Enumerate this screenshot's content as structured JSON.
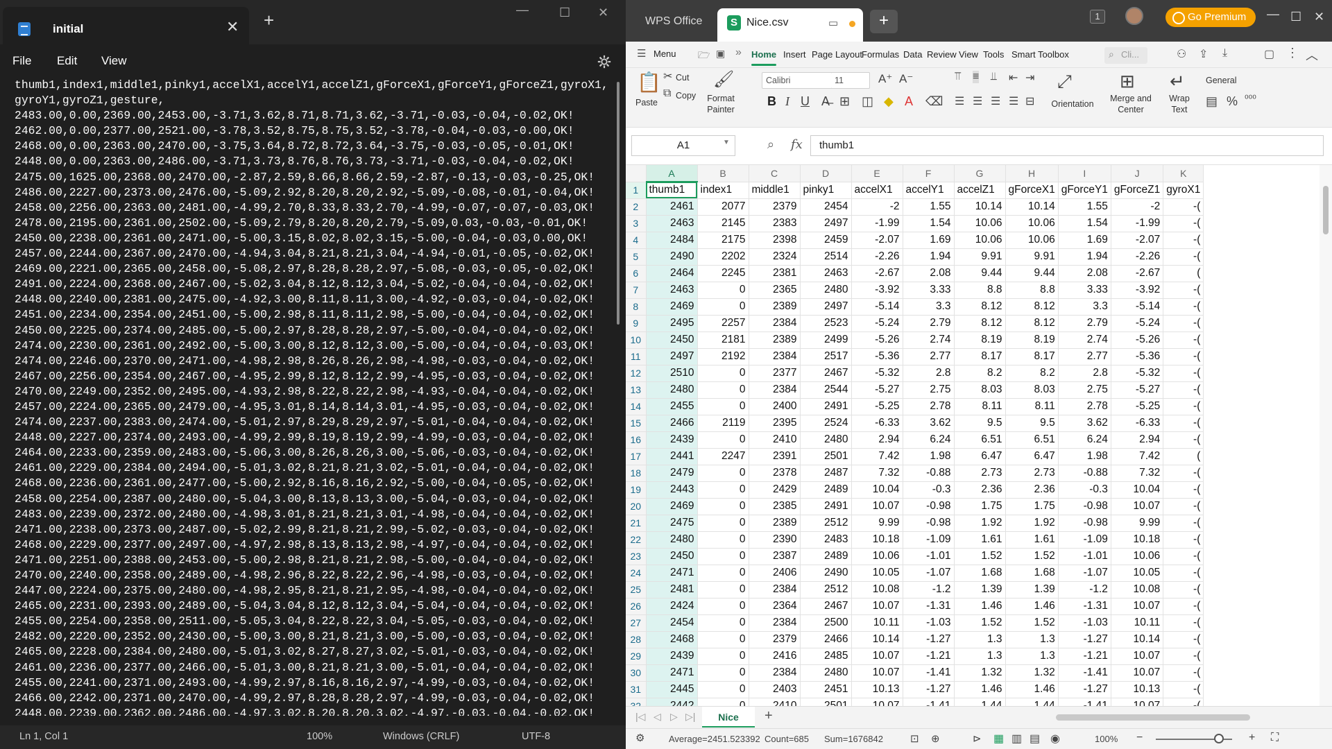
{
  "notepad": {
    "tab_title": "initial",
    "menu": [
      "File",
      "Edit",
      "View"
    ],
    "content": "thumb1,index1,middle1,pinky1,accelX1,accelY1,accelZ1,gForceX1,gForceY1,gForceZ1,gyroX1,gyroY1,gyroZ1,gesture,\n2483.00,0.00,2369.00,2453.00,-3.71,3.62,8.71,8.71,3.62,-3.71,-0.03,-0.04,-0.02,OK!\n2462.00,0.00,2377.00,2521.00,-3.78,3.52,8.75,8.75,3.52,-3.78,-0.04,-0.03,-0.00,OK!\n2468.00,0.00,2363.00,2470.00,-3.75,3.64,8.72,8.72,3.64,-3.75,-0.03,-0.05,-0.01,OK!\n2448.00,0.00,2363.00,2486.00,-3.71,3.73,8.76,8.76,3.73,-3.71,-0.03,-0.04,-0.02,OK!\n2475.00,1625.00,2368.00,2470.00,-2.87,2.59,8.66,8.66,2.59,-2.87,-0.13,-0.03,-0.25,OK!\n2486.00,2227.00,2373.00,2476.00,-5.09,2.92,8.20,8.20,2.92,-5.09,-0.08,-0.01,-0.04,OK!\n2458.00,2256.00,2363.00,2481.00,-4.99,2.70,8.33,8.33,2.70,-4.99,-0.07,-0.07,-0.03,OK!\n2478.00,2195.00,2361.00,2502.00,-5.09,2.79,8.20,8.20,2.79,-5.09,0.03,-0.03,-0.01,OK!\n2450.00,2238.00,2361.00,2471.00,-5.00,3.15,8.02,8.02,3.15,-5.00,-0.04,-0.03,0.00,OK!\n2457.00,2244.00,2367.00,2470.00,-4.94,3.04,8.21,8.21,3.04,-4.94,-0.01,-0.05,-0.02,OK!\n2469.00,2221.00,2365.00,2458.00,-5.08,2.97,8.28,8.28,2.97,-5.08,-0.03,-0.05,-0.02,OK!\n2491.00,2224.00,2368.00,2467.00,-5.02,3.04,8.12,8.12,3.04,-5.02,-0.04,-0.04,-0.02,OK!\n2448.00,2240.00,2381.00,2475.00,-4.92,3.00,8.11,8.11,3.00,-4.92,-0.03,-0.04,-0.02,OK!\n2451.00,2234.00,2354.00,2451.00,-5.00,2.98,8.11,8.11,2.98,-5.00,-0.04,-0.04,-0.02,OK!\n2450.00,2225.00,2374.00,2485.00,-5.00,2.97,8.28,8.28,2.97,-5.00,-0.04,-0.04,-0.02,OK!\n2474.00,2230.00,2361.00,2492.00,-5.00,3.00,8.12,8.12,3.00,-5.00,-0.04,-0.04,-0.03,OK!\n2474.00,2246.00,2370.00,2471.00,-4.98,2.98,8.26,8.26,2.98,-4.98,-0.03,-0.04,-0.02,OK!\n2467.00,2256.00,2354.00,2467.00,-4.95,2.99,8.12,8.12,2.99,-4.95,-0.03,-0.04,-0.02,OK!\n2470.00,2249.00,2352.00,2495.00,-4.93,2.98,8.22,8.22,2.98,-4.93,-0.04,-0.04,-0.02,OK!\n2457.00,2224.00,2365.00,2479.00,-4.95,3.01,8.14,8.14,3.01,-4.95,-0.03,-0.04,-0.02,OK!\n2474.00,2237.00,2383.00,2474.00,-5.01,2.97,8.29,8.29,2.97,-5.01,-0.04,-0.04,-0.02,OK!\n2448.00,2227.00,2374.00,2493.00,-4.99,2.99,8.19,8.19,2.99,-4.99,-0.03,-0.04,-0.02,OK!\n2464.00,2233.00,2359.00,2483.00,-5.06,3.00,8.26,8.26,3.00,-5.06,-0.03,-0.04,-0.02,OK!\n2461.00,2229.00,2384.00,2494.00,-5.01,3.02,8.21,8.21,3.02,-5.01,-0.04,-0.04,-0.02,OK!\n2468.00,2236.00,2361.00,2477.00,-5.00,2.92,8.16,8.16,2.92,-5.00,-0.04,-0.05,-0.02,OK!\n2458.00,2254.00,2387.00,2480.00,-5.04,3.00,8.13,8.13,3.00,-5.04,-0.03,-0.04,-0.02,OK!\n2483.00,2239.00,2372.00,2480.00,-4.98,3.01,8.21,8.21,3.01,-4.98,-0.04,-0.04,-0.02,OK!\n2471.00,2238.00,2373.00,2487.00,-5.02,2.99,8.21,8.21,2.99,-5.02,-0.03,-0.04,-0.02,OK!\n2468.00,2229.00,2377.00,2497.00,-4.97,2.98,8.13,8.13,2.98,-4.97,-0.04,-0.04,-0.02,OK!\n2471.00,2251.00,2388.00,2453.00,-5.00,2.98,8.21,8.21,2.98,-5.00,-0.04,-0.04,-0.02,OK!\n2470.00,2240.00,2358.00,2489.00,-4.98,2.96,8.22,8.22,2.96,-4.98,-0.03,-0.04,-0.02,OK!\n2447.00,2224.00,2375.00,2480.00,-4.98,2.95,8.21,8.21,2.95,-4.98,-0.04,-0.04,-0.02,OK!\n2465.00,2231.00,2393.00,2489.00,-5.04,3.04,8.12,8.12,3.04,-5.04,-0.04,-0.04,-0.02,OK!\n2455.00,2254.00,2358.00,2511.00,-5.05,3.04,8.22,8.22,3.04,-5.05,-0.03,-0.04,-0.02,OK!\n2482.00,2220.00,2352.00,2430.00,-5.00,3.00,8.21,8.21,3.00,-5.00,-0.03,-0.04,-0.02,OK!\n2465.00,2228.00,2384.00,2480.00,-5.01,3.02,8.27,8.27,3.02,-5.01,-0.03,-0.04,-0.02,OK!\n2461.00,2236.00,2377.00,2466.00,-5.01,3.00,8.21,8.21,3.00,-5.01,-0.04,-0.04,-0.02,OK!\n2455.00,2241.00,2371.00,2493.00,-4.99,2.97,8.16,8.16,2.97,-4.99,-0.03,-0.04,-0.02,OK!\n2466.00,2242.00,2371.00,2470.00,-4.99,2.97,8.28,8.28,2.97,-4.99,-0.03,-0.04,-0.02,OK!\n2448.00,2239.00,2362.00,2486.00,-4.97,3.02,8.20,8.20,3.02,-4.97,-0.03,-0.04,-0.02,OK!",
    "status": {
      "position": "Ln 1, Col 1",
      "zoom": "100%",
      "line_ending": "Windows (CRLF)",
      "encoding": "UTF-8"
    }
  },
  "wps": {
    "app_tab": "WPS Office",
    "file_tab": "Nice.csv",
    "badge": "1",
    "premium": "Go Premium",
    "menu_label": "Menu",
    "ribbon_tabs": [
      "Home",
      "Insert",
      "Page Layout",
      "Formulas",
      "Data",
      "Review",
      "View",
      "Tools",
      "Smart Toolbox"
    ],
    "search_placeholder": "Cli...",
    "ribbon": {
      "paste": "Paste",
      "cut": "Cut",
      "copy": "Copy",
      "format_painter_1": "Format",
      "format_painter_2": "Painter",
      "font": "Calibri",
      "size": "11",
      "orientation": "Orientation",
      "merge_1": "Merge and",
      "merge_2": "Center",
      "wrap_1": "Wrap",
      "wrap_2": "Text",
      "number_format": "General"
    },
    "name_box": "A1",
    "formula": "thumb1",
    "columns": [
      "A",
      "B",
      "C",
      "D",
      "E",
      "F",
      "G",
      "H",
      "I",
      "J",
      "K"
    ],
    "rows": [
      [
        "thumb1",
        "index1",
        "middle1",
        "pinky1",
        "accelX1",
        "accelY1",
        "accelZ1",
        "gForceX1",
        "gForceY1",
        "gForceZ1",
        "gyroX1"
      ],
      [
        "2461",
        "2077",
        "2379",
        "2454",
        "-2",
        "1.55",
        "10.14",
        "10.14",
        "1.55",
        "-2",
        "-("
      ],
      [
        "2463",
        "2145",
        "2383",
        "2497",
        "-1.99",
        "1.54",
        "10.06",
        "10.06",
        "1.54",
        "-1.99",
        "-("
      ],
      [
        "2484",
        "2175",
        "2398",
        "2459",
        "-2.07",
        "1.69",
        "10.06",
        "10.06",
        "1.69",
        "-2.07",
        "-("
      ],
      [
        "2490",
        "2202",
        "2324",
        "2514",
        "-2.26",
        "1.94",
        "9.91",
        "9.91",
        "1.94",
        "-2.26",
        "-("
      ],
      [
        "2464",
        "2245",
        "2381",
        "2463",
        "-2.67",
        "2.08",
        "9.44",
        "9.44",
        "2.08",
        "-2.67",
        "("
      ],
      [
        "2463",
        "0",
        "2365",
        "2480",
        "-3.92",
        "3.33",
        "8.8",
        "8.8",
        "3.33",
        "-3.92",
        "-("
      ],
      [
        "2469",
        "0",
        "2389",
        "2497",
        "-5.14",
        "3.3",
        "8.12",
        "8.12",
        "3.3",
        "-5.14",
        "-("
      ],
      [
        "2495",
        "2257",
        "2384",
        "2523",
        "-5.24",
        "2.79",
        "8.12",
        "8.12",
        "2.79",
        "-5.24",
        "-("
      ],
      [
        "2450",
        "2181",
        "2389",
        "2499",
        "-5.26",
        "2.74",
        "8.19",
        "8.19",
        "2.74",
        "-5.26",
        "-("
      ],
      [
        "2497",
        "2192",
        "2384",
        "2517",
        "-5.36",
        "2.77",
        "8.17",
        "8.17",
        "2.77",
        "-5.36",
        "-("
      ],
      [
        "2510",
        "0",
        "2377",
        "2467",
        "-5.32",
        "2.8",
        "8.2",
        "8.2",
        "2.8",
        "-5.32",
        "-("
      ],
      [
        "2480",
        "0",
        "2384",
        "2544",
        "-5.27",
        "2.75",
        "8.03",
        "8.03",
        "2.75",
        "-5.27",
        "-("
      ],
      [
        "2455",
        "0",
        "2400",
        "2491",
        "-5.25",
        "2.78",
        "8.11",
        "8.11",
        "2.78",
        "-5.25",
        "-("
      ],
      [
        "2466",
        "2119",
        "2395",
        "2524",
        "-6.33",
        "3.62",
        "9.5",
        "9.5",
        "3.62",
        "-6.33",
        "-("
      ],
      [
        "2439",
        "0",
        "2410",
        "2480",
        "2.94",
        "6.24",
        "6.51",
        "6.51",
        "6.24",
        "2.94",
        "-("
      ],
      [
        "2441",
        "2247",
        "2391",
        "2501",
        "7.42",
        "1.98",
        "6.47",
        "6.47",
        "1.98",
        "7.42",
        "("
      ],
      [
        "2479",
        "0",
        "2378",
        "2487",
        "7.32",
        "-0.88",
        "2.73",
        "2.73",
        "-0.88",
        "7.32",
        "-("
      ],
      [
        "2443",
        "0",
        "2429",
        "2489",
        "10.04",
        "-0.3",
        "2.36",
        "2.36",
        "-0.3",
        "10.04",
        "-("
      ],
      [
        "2469",
        "0",
        "2385",
        "2491",
        "10.07",
        "-0.98",
        "1.75",
        "1.75",
        "-0.98",
        "10.07",
        "-("
      ],
      [
        "2475",
        "0",
        "2389",
        "2512",
        "9.99",
        "-0.98",
        "1.92",
        "1.92",
        "-0.98",
        "9.99",
        "-("
      ],
      [
        "2480",
        "0",
        "2390",
        "2483",
        "10.18",
        "-1.09",
        "1.61",
        "1.61",
        "-1.09",
        "10.18",
        "-("
      ],
      [
        "2450",
        "0",
        "2387",
        "2489",
        "10.06",
        "-1.01",
        "1.52",
        "1.52",
        "-1.01",
        "10.06",
        "-("
      ],
      [
        "2471",
        "0",
        "2406",
        "2490",
        "10.05",
        "-1.07",
        "1.68",
        "1.68",
        "-1.07",
        "10.05",
        "-("
      ],
      [
        "2481",
        "0",
        "2384",
        "2512",
        "10.08",
        "-1.2",
        "1.39",
        "1.39",
        "-1.2",
        "10.08",
        "-("
      ],
      [
        "2424",
        "0",
        "2364",
        "2467",
        "10.07",
        "-1.31",
        "1.46",
        "1.46",
        "-1.31",
        "10.07",
        "-("
      ],
      [
        "2454",
        "0",
        "2384",
        "2500",
        "10.11",
        "-1.03",
        "1.52",
        "1.52",
        "-1.03",
        "10.11",
        "-("
      ],
      [
        "2468",
        "0",
        "2379",
        "2466",
        "10.14",
        "-1.27",
        "1.3",
        "1.3",
        "-1.27",
        "10.14",
        "-("
      ],
      [
        "2439",
        "0",
        "2416",
        "2485",
        "10.07",
        "-1.21",
        "1.3",
        "1.3",
        "-1.21",
        "10.07",
        "-("
      ],
      [
        "2471",
        "0",
        "2384",
        "2480",
        "10.07",
        "-1.41",
        "1.32",
        "1.32",
        "-1.41",
        "10.07",
        "-("
      ],
      [
        "2445",
        "0",
        "2403",
        "2451",
        "10.13",
        "-1.27",
        "1.46",
        "1.46",
        "-1.27",
        "10.13",
        "-("
      ],
      [
        "2442",
        "0",
        "2410",
        "2501",
        "10.07",
        "-1.41",
        "1.44",
        "1.44",
        "-1.41",
        "10.07",
        "-("
      ]
    ],
    "sheet_name": "Nice",
    "status": {
      "average": "Average=2451.523392",
      "count": "Count=685",
      "sum": "Sum=1676842",
      "zoom": "100%"
    }
  }
}
